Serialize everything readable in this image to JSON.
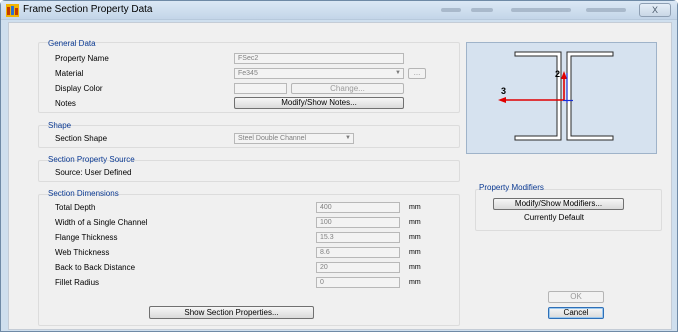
{
  "window": {
    "title": "Frame Section Property Data",
    "close_label": "X"
  },
  "general": {
    "title": "General Data",
    "property_name_label": "Property Name",
    "property_name_value": "FSec2",
    "material_label": "Material",
    "material_value": "Fe345",
    "material_more_label": "...",
    "display_color_label": "Display Color",
    "change_label": "Change...",
    "notes_label": "Notes",
    "modify_notes_label": "Modify/Show Notes..."
  },
  "shape": {
    "title": "Shape",
    "section_shape_label": "Section Shape",
    "section_shape_value": "Steel Double Channel"
  },
  "source": {
    "title": "Section Property Source",
    "source_text": "Source:  User Defined"
  },
  "dimensions": {
    "title": "Section Dimensions",
    "rows": [
      {
        "label": "Total Depth",
        "value": "400",
        "unit": "mm"
      },
      {
        "label": "Width of a Single Channel",
        "value": "100",
        "unit": "mm"
      },
      {
        "label": "Flange Thickness",
        "value": "15.3",
        "unit": "mm"
      },
      {
        "label": "Web Thickness",
        "value": "8.6",
        "unit": "mm"
      },
      {
        "label": "Back to Back Distance",
        "value": "20",
        "unit": "mm"
      },
      {
        "label": "Fillet Radius",
        "value": "0",
        "unit": "mm"
      }
    ],
    "show_properties_label": "Show Section Properties..."
  },
  "preview": {
    "axis_2_label": "2",
    "axis_3_label": "3",
    "axis_color": "#e00000",
    "centroid_color": "#1a2fd6"
  },
  "modifiers": {
    "title": "Property Modifiers",
    "modify_label": "Modify/Show Modifiers...",
    "status": "Currently Default"
  },
  "buttons": {
    "ok_label": "OK",
    "cancel_label": "Cancel"
  },
  "colors": {
    "group_title": "#0b3a93",
    "window_frame": "#cfdfee",
    "client_bg": "#f0f0f0"
  }
}
